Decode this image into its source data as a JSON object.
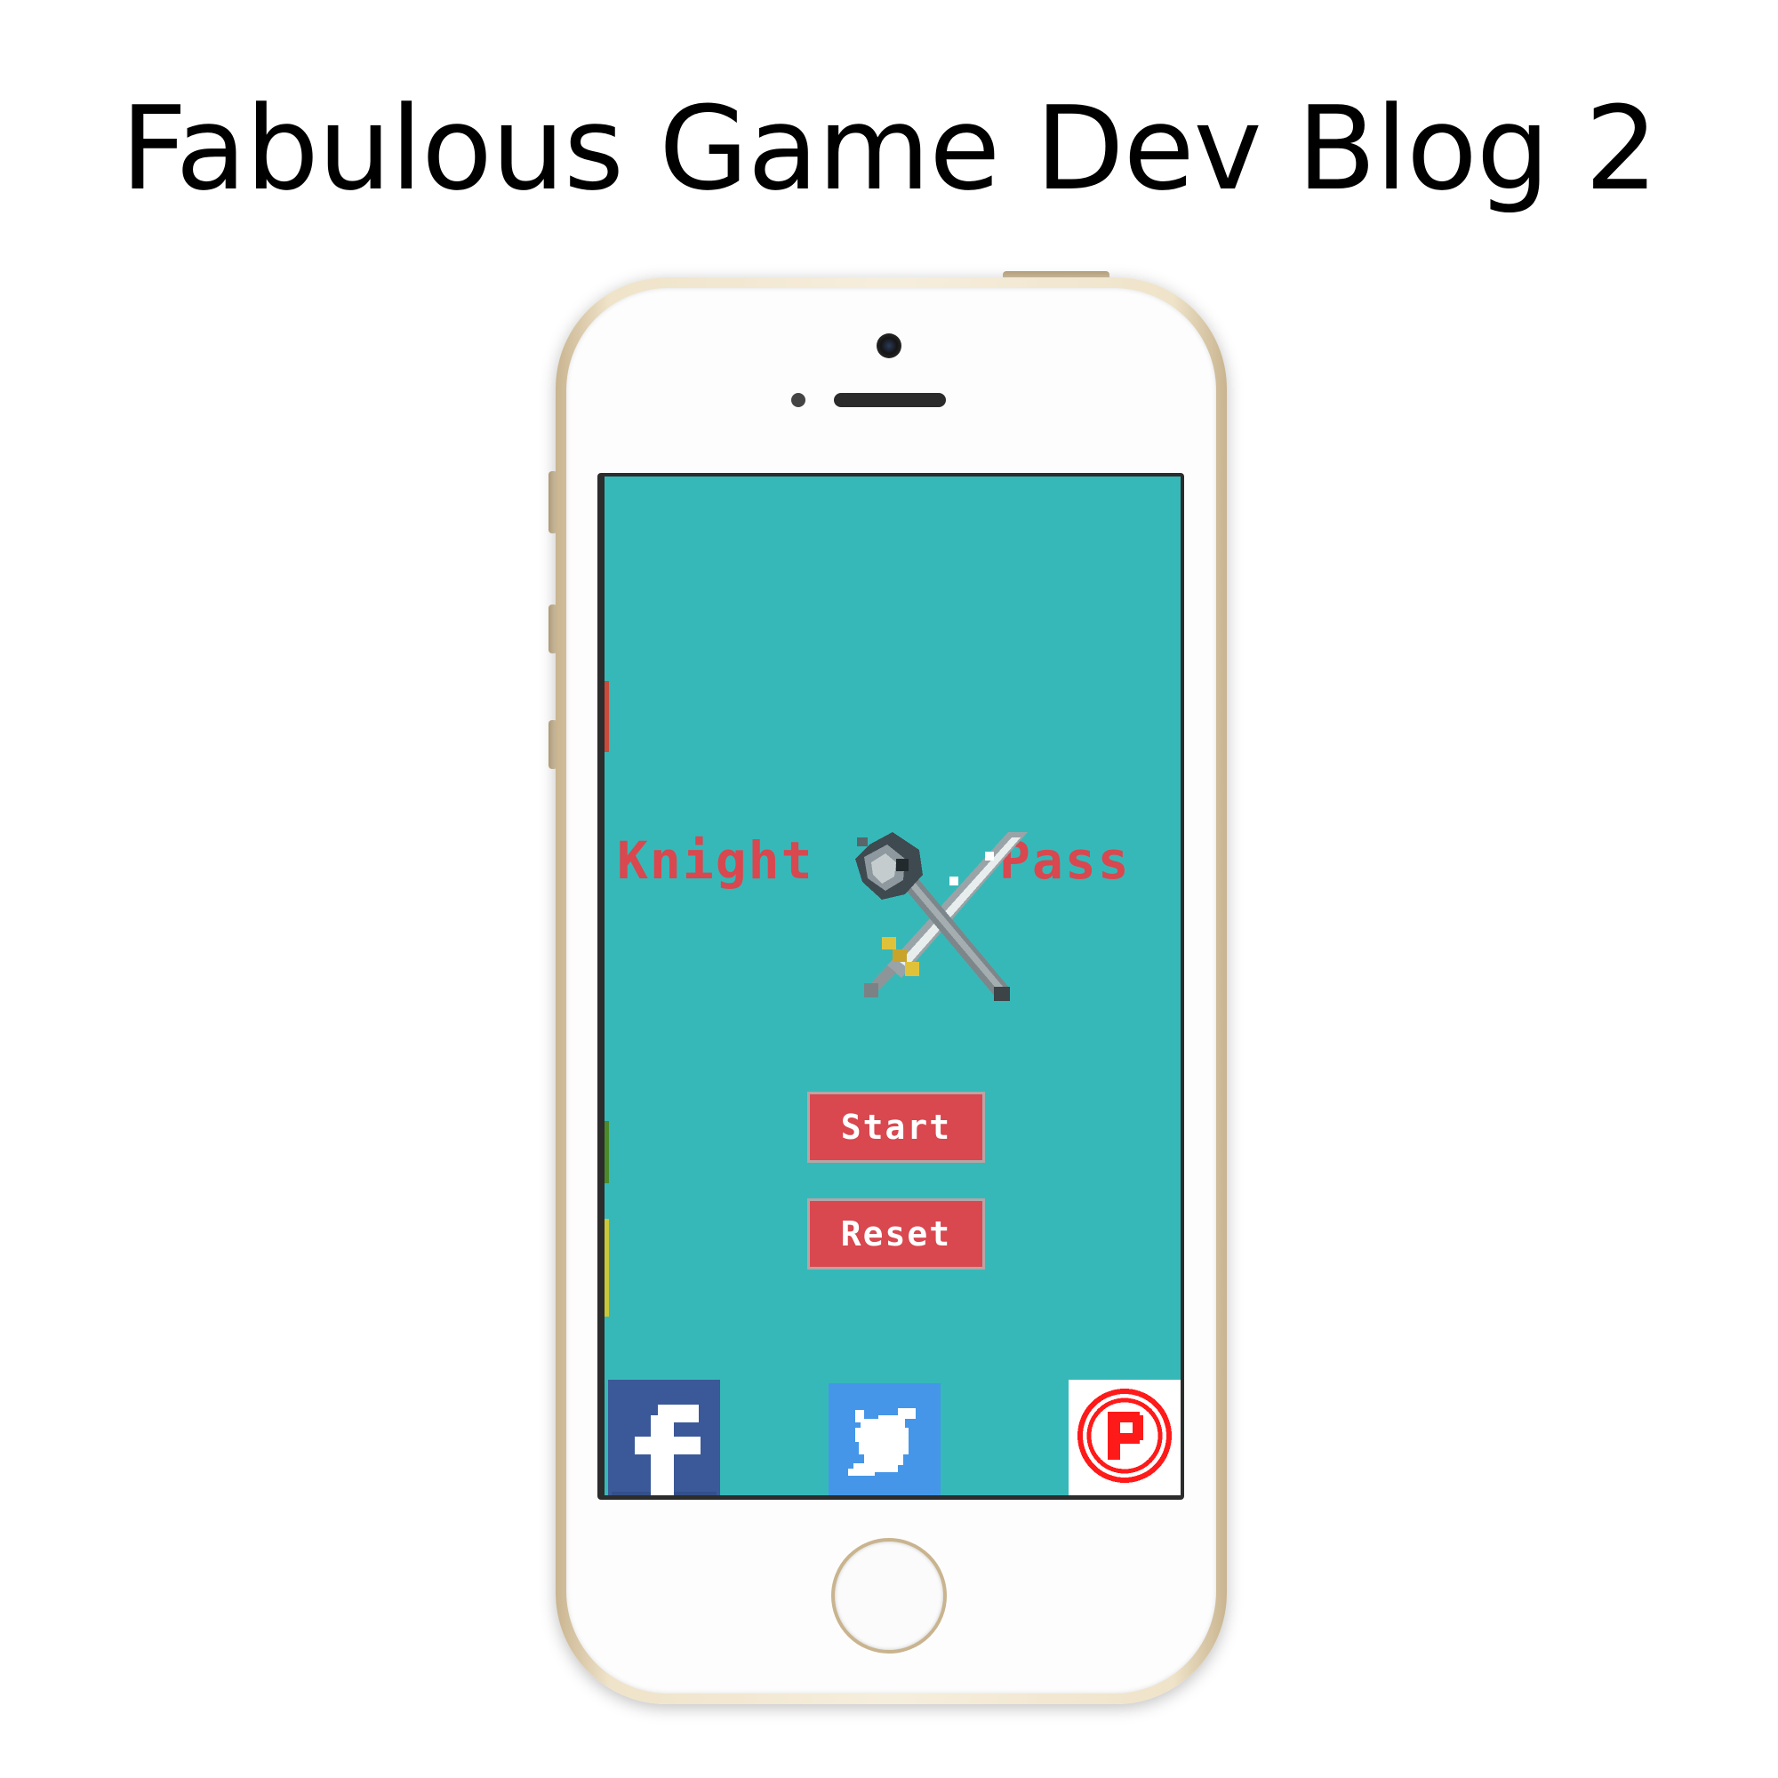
{
  "page": {
    "title": "Fabulous Game Dev Blog 2"
  },
  "game": {
    "title_word_1": "Knight",
    "title_word_2": "Pass",
    "buttons": {
      "start": "Start",
      "reset": "Reset"
    },
    "social": {
      "facebook_icon": "facebook-icon",
      "twitter_icon": "twitter-icon",
      "p_icon": "p-badge-icon",
      "facebook_letter": "f",
      "p_letter": "P"
    }
  },
  "colors": {
    "screen_bg": "#37b8b8",
    "accent_red": "#d9474f",
    "facebook_blue": "#3b5998",
    "twitter_blue": "#4596e8",
    "phone_gold": "#c9b48f"
  }
}
